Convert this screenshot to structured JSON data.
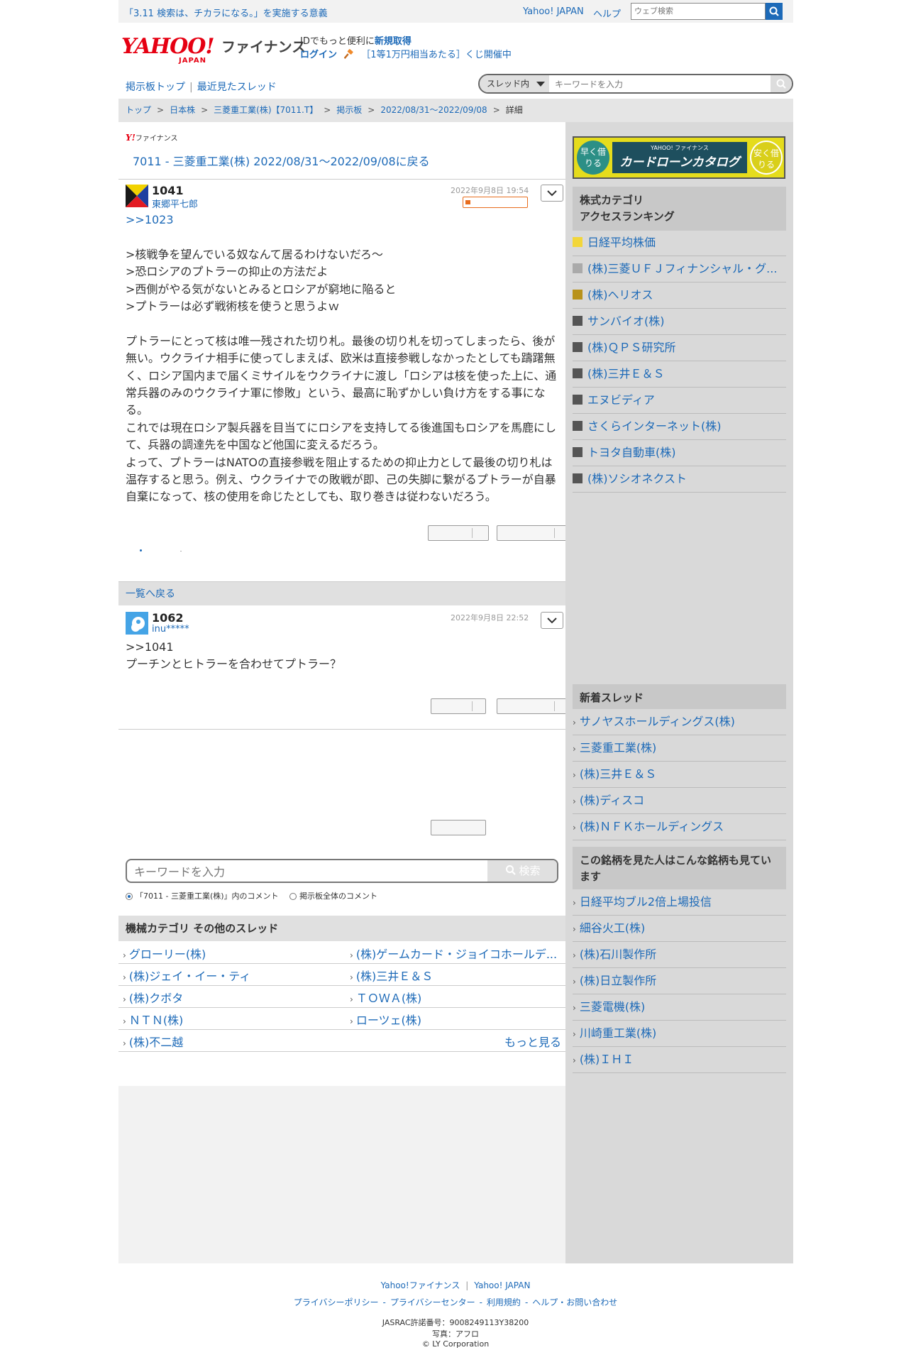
{
  "topbar": {
    "announce": "「3.11 検索は、チカラになる。」を実施する意義",
    "yahoo_japan": "Yahoo! JAPAN",
    "help": "ヘルプ",
    "web_search_placeholder": "ウェブ検索"
  },
  "header": {
    "logo_yahoo": "YAHOO!",
    "logo_japan": "JAPAN",
    "logo_finance": "ファイナンス",
    "id_text": "IDでもっと便利に",
    "id_signup": "新規取得",
    "login": "ログイン",
    "kuji": "［1等1万円相当あたる］くじ開催中"
  },
  "boardnav": {
    "board_top": "掲示板トップ",
    "sep": "|",
    "recent": "最近見たスレッド",
    "scope": "スレッド内",
    "keyword_placeholder": "キーワードを入力"
  },
  "breadcrumb": [
    "トップ",
    "日本株",
    "三菱重工業(株)【7011.T】",
    "掲示板",
    "2022/08/31〜2022/09/08",
    "詳細"
  ],
  "thread": {
    "mini_logo_y": "Y!",
    "mini_logo_text": "ファイナンス",
    "back_link": "7011 - 三菱重工業(株) 2022/08/31〜2022/09/08に戻る"
  },
  "comments": [
    {
      "number": "1041",
      "user": "東郷平七郎",
      "date": "2022年9月8日 19:54",
      "lines": [
        ">>1023",
        "",
        ">核戦争を望んでいる奴なんて居るわけないだろ〜",
        ">恐ロシアのプトラーの抑止の方法だよ",
        ">西側がやる気がないとみるとロシアが窮地に陥ると",
        ">プトラーは必ず戦術核を使うと思うよｗ",
        "",
        "プトラーにとって核は唯一残された切り札。最後の切り札を切ってしまったら、後が",
        "無い。ウクライナ相手に使ってしまえば、欧米は直接参戦しなかったとしても躊躇無",
        "く、ロシア国内まで届くミサイルをウクライナに渡し「ロシアは核を使った上に、通",
        "常兵器のみのウクライナ軍に惨敗」という、最高に恥ずかしい負け方をする事にな",
        "る。",
        "これでは現在ロシア製兵器を目当てにロシアを支持してる後進国もロシアを馬鹿にし",
        "て、兵器の調達先を中国など他国に変えるだろう。",
        "よって、プトラーはNATOの直接参戦を阻止するための抑止力として最後の切り札は",
        "温存すると思う。例え、ウクライナでの敗戦が即、己の失脚に繋がるプトラーが自暴",
        "自棄になって、核の使用を命じたとしても、取り巻きは従わないだろう。"
      ]
    },
    {
      "number": "1062",
      "user": "inu*****",
      "date": "2022年9月8日 22:52",
      "lines": [
        ">>1041",
        "プーチンとヒトラーを合わせてプトラー？"
      ]
    }
  ],
  "list_back": "一覧へ戻る",
  "search": {
    "placeholder": "キーワードを入力",
    "button": "検索",
    "radio_thread": "「7011 - 三菱重工業(株)」内のコメント",
    "radio_all": "掲示板全体のコメント"
  },
  "other_threads": {
    "title": "機械カテゴリ その他のスレッド",
    "items": [
      "グローリー(株)",
      "(株)ゲームカード・ジョイコホールデ...",
      "(株)ジェイ・イー・ティ",
      "(株)三井Ｅ＆Ｓ",
      "(株)クボタ",
      "ＴＯＷＡ(株)",
      "ＮＴＮ(株)",
      "ローツェ(株)",
      "(株)不二越"
    ],
    "more": "もっと見る"
  },
  "ad": {
    "left": "早く借りる",
    "right": "安く借りる",
    "top": "YAHOO! ファイナンス",
    "main": "カードローンカタログ"
  },
  "ranking": {
    "title_line1": "株式カテゴリ",
    "title_line2": "アクセスランキング",
    "items": [
      {
        "label": "日経平均株価",
        "color": "#f2d63a"
      },
      {
        "label": "(株)三菱ＵＦＪフィナンシャル・グ...",
        "color": "#aaaaaa"
      },
      {
        "label": "(株)ヘリオス",
        "color": "#b8921a"
      },
      {
        "label": "サンバイオ(株)",
        "color": "#555555"
      },
      {
        "label": "(株)ＱＰＳ研究所",
        "color": "#555555"
      },
      {
        "label": "(株)三井Ｅ＆Ｓ",
        "color": "#555555"
      },
      {
        "label": "エヌビディア",
        "color": "#555555"
      },
      {
        "label": "さくらインターネット(株)",
        "color": "#555555"
      },
      {
        "label": "トヨタ自動車(株)",
        "color": "#555555"
      },
      {
        "label": "(株)ソシオネクスト",
        "color": "#555555"
      }
    ]
  },
  "new_threads": {
    "title": "新着スレッド",
    "items": [
      "サノヤスホールディングス(株)",
      "三菱重工業(株)",
      "(株)三井Ｅ＆Ｓ",
      "(株)ディスコ",
      "(株)ＮＦＫホールディングス"
    ]
  },
  "also_viewed": {
    "title": "この銘柄を見た人はこんな銘柄も見ています",
    "items": [
      "日経平均ブル2倍上場投信",
      "細谷火工(株)",
      "(株)石川製作所",
      "(株)日立製作所",
      "三菱電機(株)",
      "川崎重工業(株)",
      "(株)ＩＨＩ"
    ]
  },
  "footer": {
    "yf": "Yahoo!ファイナンス",
    "yj": "Yahoo! JAPAN",
    "privacy": "プライバシーポリシー",
    "privacy_center": "プライバシーセンター",
    "terms": "利用規約",
    "help": "ヘルプ・お問い合わせ",
    "jasrac": "JASRAC許諾番号：9008249113Y38200",
    "photo": "写真：アフロ",
    "copyright": "© LY Corporation"
  }
}
